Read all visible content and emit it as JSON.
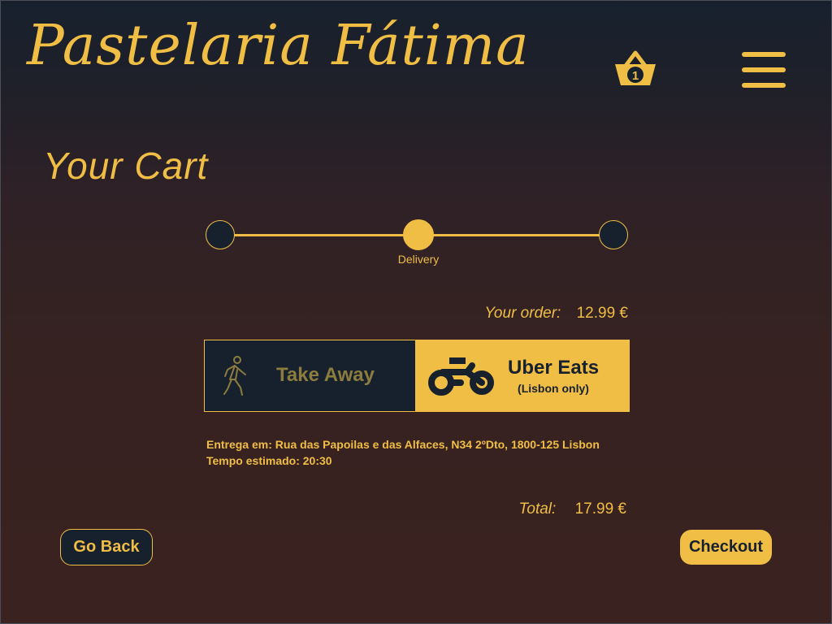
{
  "header": {
    "brand": "Pastelaria Fátima",
    "cart_count": "1",
    "cart_icon": "basket-icon",
    "menu_icon": "hamburger-menu-icon"
  },
  "page_title": "Your Cart",
  "stepper": {
    "steps": [
      "",
      "Delivery",
      ""
    ],
    "active_index": 1
  },
  "order": {
    "label": "Your order:",
    "value": "12.99 €"
  },
  "delivery_options": {
    "take_away": {
      "label": "Take Away",
      "icon": "walking-person-icon"
    },
    "uber_eats": {
      "label": "Uber Eats",
      "sublabel": "(Lisbon only)",
      "icon": "motorcycle-icon"
    },
    "selected": "uber_eats"
  },
  "delivery_info": {
    "address": "Entrega em: Rua das Papoilas e das Alfaces, N34 2ºDto, 1800-125 Lisbon",
    "eta": "Tempo estimado: 20:30"
  },
  "total": {
    "label": "Total:",
    "value": "17.99 €"
  },
  "buttons": {
    "back": "Go Back",
    "checkout": "Checkout"
  },
  "colors": {
    "accent": "#f0bd45",
    "dark": "#17212e",
    "background": "#3a2220"
  }
}
